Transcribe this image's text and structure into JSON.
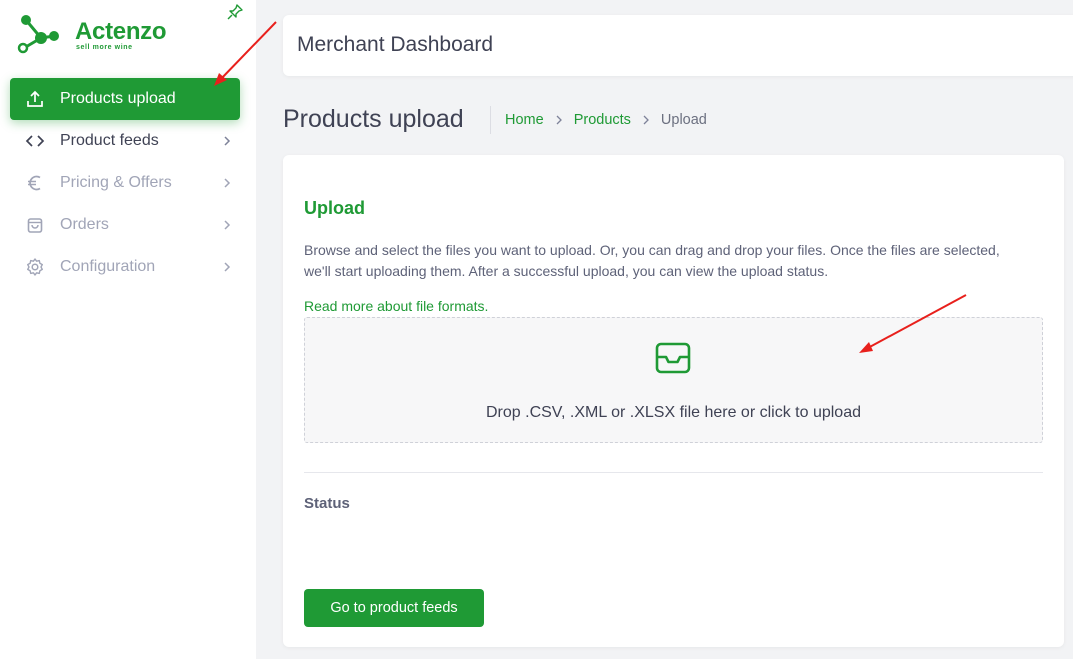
{
  "brand": {
    "name": "Actenzo",
    "tagline": "sell more wine",
    "color": "#1f9a35"
  },
  "sidebar": {
    "items": [
      {
        "label": "Products upload",
        "icon": "upload-icon",
        "state": "active"
      },
      {
        "label": "Product feeds",
        "icon": "code-icon",
        "state": "normal"
      },
      {
        "label": "Pricing & Offers",
        "icon": "euro-icon",
        "state": "dim"
      },
      {
        "label": "Orders",
        "icon": "shopping-bag-icon",
        "state": "dim"
      },
      {
        "label": "Configuration",
        "icon": "gear-icon",
        "state": "dim"
      }
    ]
  },
  "header": {
    "title": "Merchant Dashboard"
  },
  "page": {
    "title": "Products upload",
    "breadcrumb": {
      "home": "Home",
      "products": "Products",
      "current": "Upload"
    }
  },
  "upload": {
    "title": "Upload",
    "description": "Browse and select the files you want to upload. Or, you can drag and drop your files. Once the files are selected, we'll start uploading them. After a successful upload, you can view the upload status.",
    "read_more": "Read more about file formats.",
    "drop_text": "Drop .CSV, .XML or .XLSX file here or click to upload",
    "drop_icon": "inbox-icon"
  },
  "status": {
    "label": "Status"
  },
  "actions": {
    "go_to_feeds": "Go to product feeds"
  }
}
